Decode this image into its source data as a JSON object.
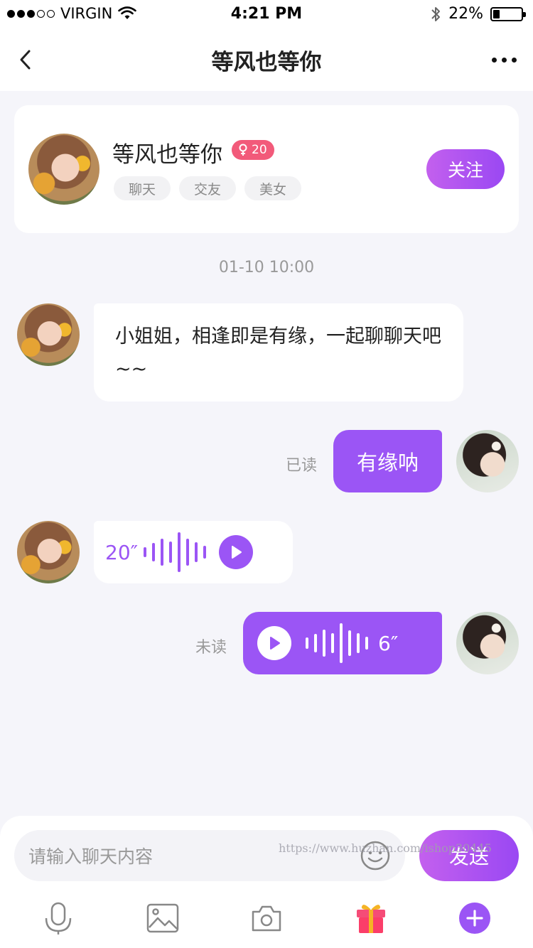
{
  "status_bar": {
    "carrier": "VIRGIN",
    "time": "4:21 PM",
    "battery_text": "22%",
    "battery_level": 0.22,
    "signal_bars_filled": 3,
    "signal_bars_total": 5
  },
  "nav": {
    "title": "等风也等你",
    "back_icon": "chevron-left-icon",
    "more_icon": "more-dots-icon"
  },
  "profile": {
    "name": "等风也等你",
    "level": "20",
    "level_icon": "female-icon",
    "tags": [
      "聊天",
      "交友",
      "美女"
    ],
    "follow_label": "关注"
  },
  "chat": {
    "timestamp": "01-10 10:00",
    "messages": [
      {
        "text": "小姐姐，相逢即是有缘，一起聊聊天吧~~"
      },
      {
        "text": "有缘呐",
        "status": "已读"
      },
      {
        "duration": "20″"
      },
      {
        "duration": "6″",
        "status": "未读"
      }
    ]
  },
  "input": {
    "placeholder": "请输入聊天内容",
    "send_label": "发送",
    "watermark": "https://www.huzhan.com/ishop30445"
  },
  "toolbar": {
    "icons": [
      "microphone-icon",
      "image-icon",
      "camera-icon",
      "gift-icon",
      "plus-icon"
    ]
  },
  "colors": {
    "accent": "#9b55f5",
    "accent_gradient_start": "#c360ee",
    "badge": "#f25a7a",
    "background": "#f5f5fa"
  }
}
